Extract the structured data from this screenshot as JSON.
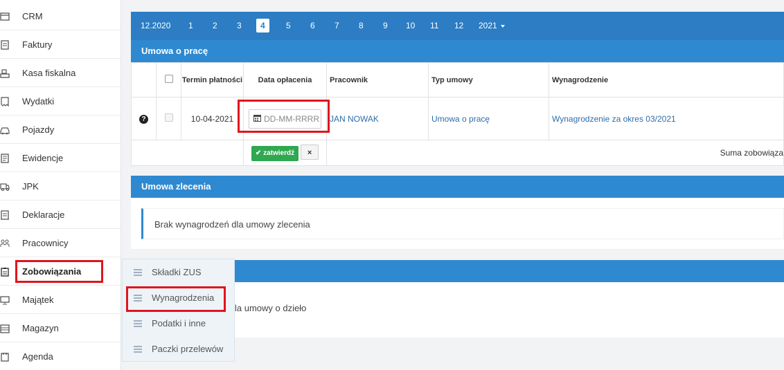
{
  "sidebar": {
    "items": [
      {
        "label": "CRM",
        "icon": "window-icon"
      },
      {
        "label": "Faktury",
        "icon": "invoice-icon"
      },
      {
        "label": "Kasa fiskalna",
        "icon": "cash-register-icon"
      },
      {
        "label": "Wydatki",
        "icon": "receipt-icon"
      },
      {
        "label": "Pojazdy",
        "icon": "car-icon"
      },
      {
        "label": "Ewidencje",
        "icon": "records-icon"
      },
      {
        "label": "JPK",
        "icon": "truck-icon"
      },
      {
        "label": "Deklaracje",
        "icon": "document-icon"
      },
      {
        "label": "Pracownicy",
        "icon": "users-icon"
      },
      {
        "label": "Zobowiązania",
        "icon": "clipboard-icon"
      },
      {
        "label": "Majątek",
        "icon": "monitor-icon"
      },
      {
        "label": "Magazyn",
        "icon": "warehouse-icon"
      },
      {
        "label": "Agenda",
        "icon": "agenda-icon"
      }
    ]
  },
  "submenu": {
    "items": [
      {
        "label": "Składki ZUS"
      },
      {
        "label": "Wynagrodzenia"
      },
      {
        "label": "Podatki i inne"
      },
      {
        "label": "Paczki przelewów"
      }
    ]
  },
  "month_bar": {
    "prev_label": "12.2020",
    "months": [
      "1",
      "2",
      "3",
      "4",
      "5",
      "6",
      "7",
      "8",
      "9",
      "10",
      "11",
      "12"
    ],
    "active": "4",
    "year_label": "2021"
  },
  "umowa_o_prace": {
    "title": "Umowa o pracę",
    "columns": {
      "termin": "Termin płatności",
      "data_oplacenia": "Data opłacenia",
      "pracownik": "Pracownik",
      "typ_umowy": "Typ umowy",
      "wynagrodzenie": "Wynagrodzenie"
    },
    "row": {
      "termin": "10-04-2021",
      "date_placeholder": "DD-MM-RRRR",
      "pracownik": "JAN NOWAK",
      "typ_umowy": "Umowa o pracę",
      "wynagrodzenie": "Wynagrodzenie za okres 03/2021"
    },
    "confirm_label": "zatwierdź",
    "cancel_label": "×",
    "sum_label": "Suma zobowiąza"
  },
  "umowa_zlecenia": {
    "title": "Umowa zlecenia",
    "empty": "Brak wynagrodzeń dla umowy zlecenia"
  },
  "umowa_o_dzielo": {
    "empty_partial": "la umowy o dzieło"
  },
  "colors": {
    "primary": "#2c7dc3",
    "section_header": "#2f89d0",
    "highlight": "#e0141c",
    "success": "#2fa84f"
  }
}
